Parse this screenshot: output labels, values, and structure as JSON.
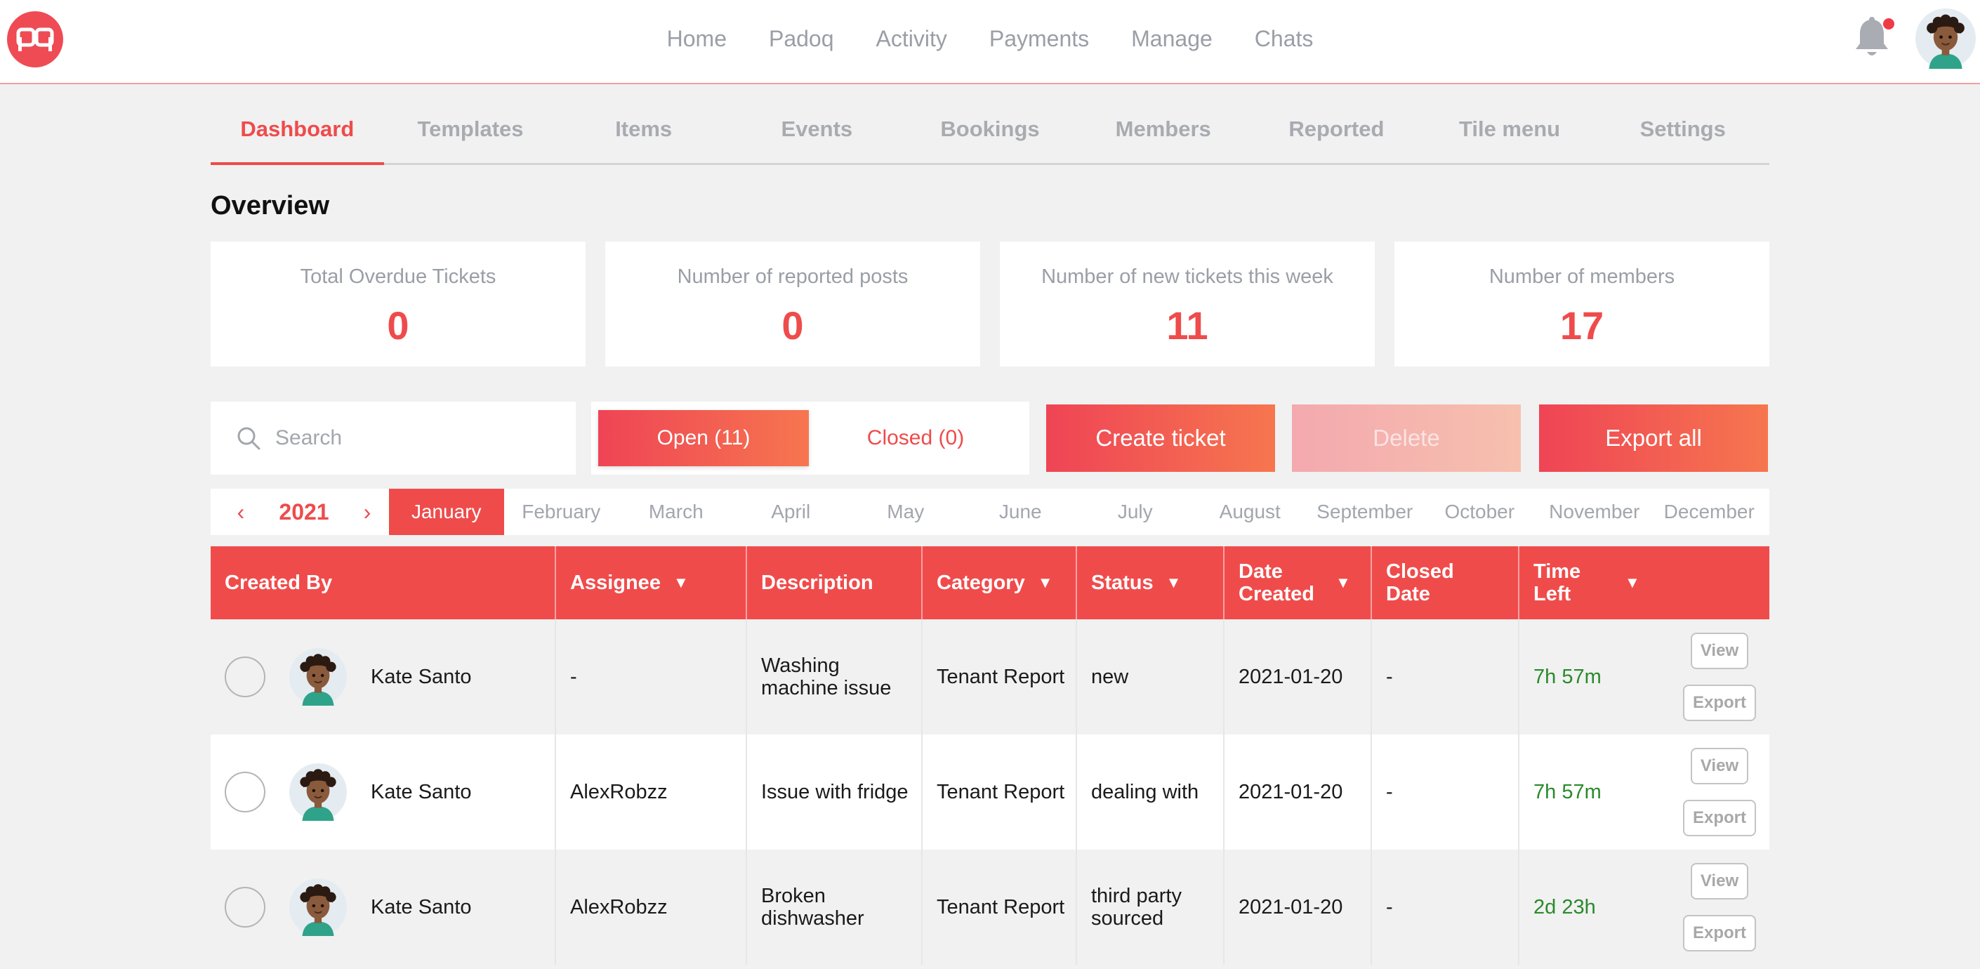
{
  "brand": {
    "logo_text": "pq",
    "accent": "#ef4b4b",
    "gradient_start": "#ef4455",
    "gradient_end": "#f6764f"
  },
  "nav": {
    "items": [
      "Home",
      "Padoq",
      "Activity",
      "Payments",
      "Manage",
      "Chats"
    ]
  },
  "subtabs": {
    "items": [
      "Dashboard",
      "Templates",
      "Items",
      "Events",
      "Bookings",
      "Members",
      "Reported",
      "Tile menu",
      "Settings"
    ],
    "active": "Dashboard"
  },
  "overview": {
    "title": "Overview",
    "cards": [
      {
        "label": "Total Overdue Tickets",
        "value": "0"
      },
      {
        "label": "Number of reported posts",
        "value": "0"
      },
      {
        "label": "Number of new tickets this week",
        "value": "11"
      },
      {
        "label": "Number of members",
        "value": "17"
      }
    ]
  },
  "toolbar": {
    "search_placeholder": "Search",
    "open_label": "Open (11)",
    "closed_label": "Closed (0)",
    "create_label": "Create ticket",
    "delete_label": "Delete",
    "export_all_label": "Export all"
  },
  "calendar": {
    "prev": "‹",
    "next": "›",
    "year": "2021",
    "months": [
      "January",
      "February",
      "March",
      "April",
      "May",
      "June",
      "July",
      "August",
      "September",
      "October",
      "November",
      "December"
    ],
    "active_month": "January"
  },
  "table": {
    "headers": [
      "Created By",
      "Assignee",
      "Description",
      "Category",
      "Status",
      "Date Created",
      "Closed Date",
      "Time Left"
    ],
    "sortable": [
      false,
      true,
      false,
      true,
      true,
      true,
      false,
      true
    ],
    "view_label": "View",
    "export_label": "Export",
    "rows": [
      {
        "creator": "Kate Santo",
        "assignee": "-",
        "description": "Washing machine issue",
        "category": "Tenant Report",
        "status": "new",
        "date_created": "2021-01-20",
        "closed_date": "-",
        "time_left": "7h 57m"
      },
      {
        "creator": "Kate Santo",
        "assignee": "AlexRobzz",
        "description": "Issue with fridge",
        "category": "Tenant Report",
        "status": "dealing with",
        "date_created": "2021-01-20",
        "closed_date": "-",
        "time_left": "7h 57m"
      },
      {
        "creator": "Kate Santo",
        "assignee": "AlexRobzz",
        "description": "Broken dishwasher",
        "category": "Tenant Report",
        "status": "third party sourced",
        "date_created": "2021-01-20",
        "closed_date": "-",
        "time_left": "2d 23h"
      }
    ]
  }
}
